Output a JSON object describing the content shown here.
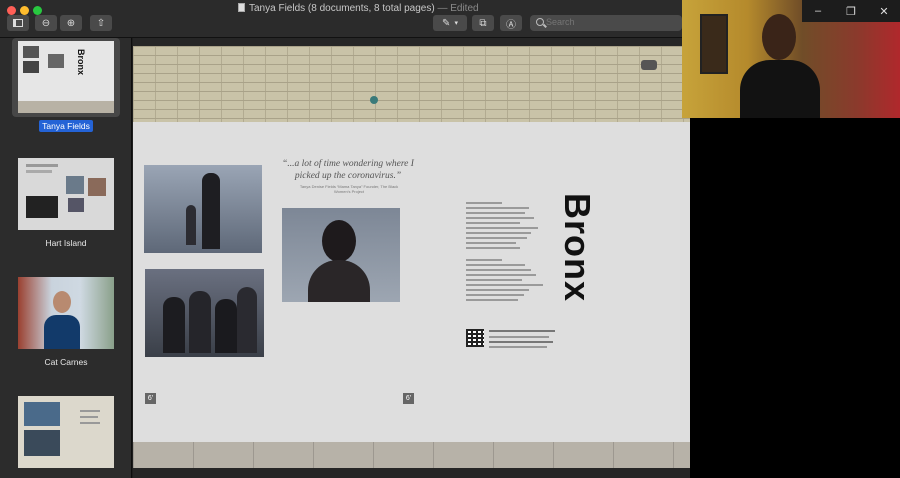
{
  "titlebar": {
    "document_title": "Tanya Fields (8 documents, 8 total pages)",
    "edited_suffix": "— Edited"
  },
  "search": {
    "placeholder": "Search"
  },
  "sidebar": {
    "items": [
      {
        "label": "Tanya Fields",
        "selected": true
      },
      {
        "label": "Hart Island",
        "selected": false
      },
      {
        "label": "Cat Carnes",
        "selected": false
      },
      {
        "label": "",
        "selected": false
      }
    ]
  },
  "page": {
    "thumb_word": "Bronx",
    "quote": "“...a lot of time wondering where I picked up the coronavirus.”",
    "attribution": "Tanya Denise Fields “Mama Tanya” Founder, The Black Women’s Project",
    "heading": "Bronx",
    "marker": "6'"
  },
  "window_controls": {
    "minimize": "–",
    "restore": "❐",
    "close": "✕"
  },
  "colors": {
    "selection": "#2463d6",
    "hoarding": "#dedede",
    "brick": "#c9c3a8"
  }
}
